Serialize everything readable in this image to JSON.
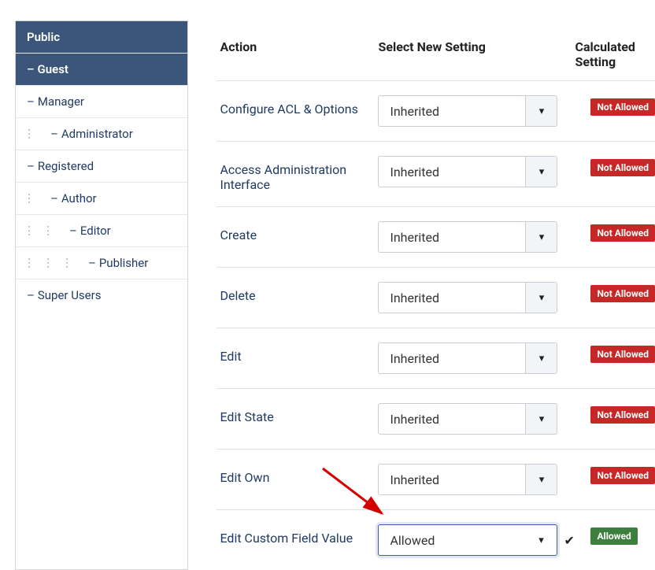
{
  "sidebar": {
    "items": [
      {
        "label": "Public",
        "active": true,
        "indent": 0
      },
      {
        "label": "Guest",
        "active": true,
        "indent": 1,
        "dash": true
      },
      {
        "label": "Manager",
        "indent": 1,
        "dash": true
      },
      {
        "label": "Administrator",
        "indent": 2,
        "dash": true,
        "dots": 1
      },
      {
        "label": "Registered",
        "indent": 1,
        "dash": true
      },
      {
        "label": "Author",
        "indent": 2,
        "dash": true,
        "dots": 1
      },
      {
        "label": "Editor",
        "indent": 3,
        "dash": true,
        "dots": 2
      },
      {
        "label": "Publisher",
        "indent": 4,
        "dash": true,
        "dots": 3
      },
      {
        "label": "Super Users",
        "indent": 1,
        "dash": true
      }
    ]
  },
  "headers": {
    "action": "Action",
    "select": "Select New Setting",
    "calc": "Calculated Setting"
  },
  "rows": [
    {
      "action": "Configure ACL & Options",
      "setting": "Inherited",
      "calc": "Not Allowed",
      "calc_color": "red"
    },
    {
      "action": "Access Administration Interface",
      "setting": "Inherited",
      "calc": "Not Allowed",
      "calc_color": "red"
    },
    {
      "action": "Create",
      "setting": "Inherited",
      "calc": "Not Allowed",
      "calc_color": "red"
    },
    {
      "action": "Delete",
      "setting": "Inherited",
      "calc": "Not Allowed",
      "calc_color": "red"
    },
    {
      "action": "Edit",
      "setting": "Inherited",
      "calc": "Not Allowed",
      "calc_color": "red"
    },
    {
      "action": "Edit State",
      "setting": "Inherited",
      "calc": "Not Allowed",
      "calc_color": "red"
    },
    {
      "action": "Edit Own",
      "setting": "Inherited",
      "calc": "Not Allowed",
      "calc_color": "red"
    },
    {
      "action": "Edit Custom Field Value",
      "setting": "Allowed",
      "calc": "Allowed",
      "calc_color": "green",
      "highlighted": true,
      "check": true
    }
  ]
}
